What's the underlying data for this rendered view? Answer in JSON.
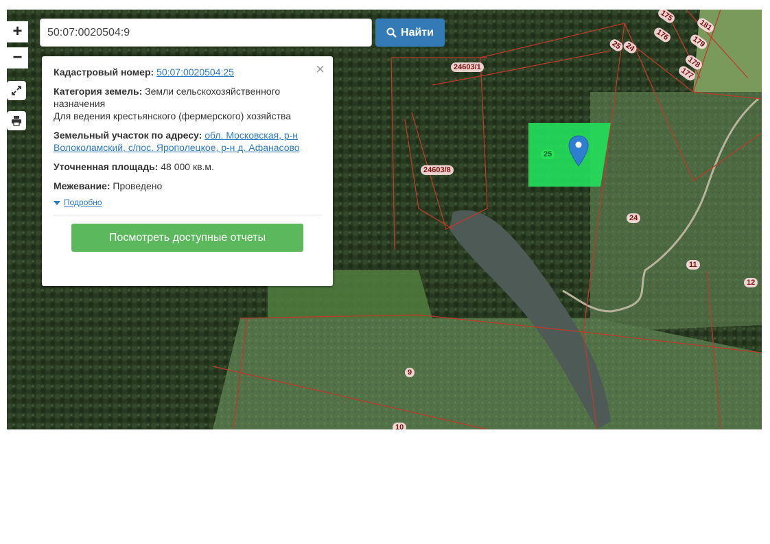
{
  "search": {
    "value": "50:07:0020504:9",
    "button_label": "Найти"
  },
  "zoom": {
    "in_label": "+",
    "out_label": "−"
  },
  "icons": {
    "search": "search-icon",
    "fullscreen": "fullscreen-icon",
    "print": "print-icon",
    "marker": "map-marker-icon",
    "close": "close-icon"
  },
  "popup": {
    "cadastral_label": "Кадастровый номер:",
    "cadastral_value": "50:07:0020504:25",
    "category_label": "Категория земель:",
    "category_value": "Земли сельскохозяйственного назначения",
    "usage": "Для ведения крестьянского (фермерского) хозяйства",
    "address_label": "Земельный участок по адресу:",
    "address_value": "обл. Московская, р-н Волоколамский, с/пос. Ярополецкое, р-н д. Афанасово",
    "area_label": "Уточненная площадь:",
    "area_value": "48 000 кв.м.",
    "survey_label": "Межевание:",
    "survey_value": "Проведено",
    "more_label": "Подробно",
    "close_label": "×",
    "report_button": "Посмотреть доступные отчеты"
  },
  "parcel_labels": [
    "175",
    "181",
    "176",
    "179",
    "178",
    "177",
    "25",
    "24",
    "24603/1",
    "24603/8",
    "25",
    "24",
    "11",
    "12",
    "9",
    "10"
  ],
  "colors": {
    "accent": "#337ab7",
    "report": "#5cb85c",
    "highlight": "#22e05a",
    "boundary": "#c0392b",
    "link": "#2a7ac6"
  }
}
